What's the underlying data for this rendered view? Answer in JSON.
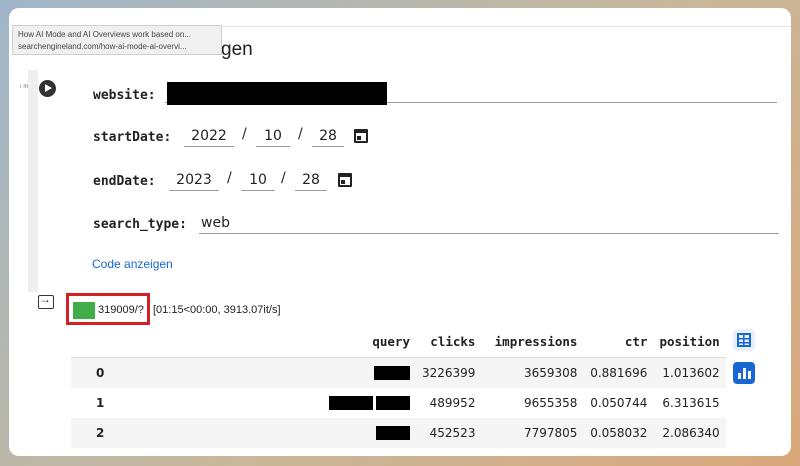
{
  "tooltip": {
    "title": "How AI Mode and AI Overviews work based on...",
    "url": "searchengineland.com/how-ai-mode-ai-overvi..."
  },
  "heading": "gen",
  "margin_mark": "ı m",
  "form": {
    "website": {
      "label": "website:",
      "value": ""
    },
    "startDate": {
      "label": "startDate:",
      "year": "2022",
      "month": "10",
      "day": "28",
      "separator": "/"
    },
    "endDate": {
      "label": "endDate:",
      "year": "2023",
      "month": "10",
      "day": "28",
      "separator": "/"
    },
    "search_type": {
      "label": "search_type:",
      "value": "web"
    }
  },
  "code_link": "Code anzeigen",
  "progress": {
    "count": "319009/?",
    "detail": "[01:15<00:00, 3913.07it/s]"
  },
  "table": {
    "columns": [
      "",
      "query",
      "clicks",
      "impressions",
      "ctr",
      "position"
    ],
    "rows": [
      {
        "index": "0",
        "clicks": "3226399",
        "impressions": "3659308",
        "ctr": "0.881696",
        "position": "1.013602"
      },
      {
        "index": "1",
        "clicks": "489952",
        "impressions": "9655358",
        "ctr": "0.050744",
        "position": "6.313615"
      },
      {
        "index": "2",
        "clicks": "452523",
        "impressions": "7797805",
        "ctr": "0.058032",
        "position": "2.086340"
      }
    ]
  },
  "colors": {
    "accent": "#1967d2",
    "progress_green": "#3fae49",
    "highlight_red": "#d32027"
  },
  "icons": [
    "play-icon",
    "calendar-icon",
    "output-icon",
    "table-icon",
    "bar-chart-icon"
  ]
}
